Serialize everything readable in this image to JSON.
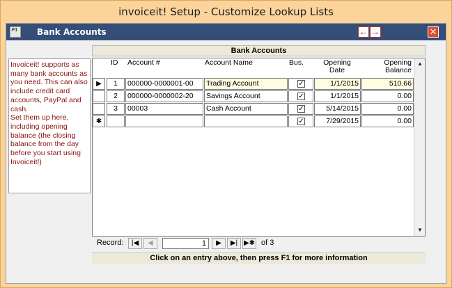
{
  "window": {
    "title": "invoiceit! Setup - Customize Lookup Lists"
  },
  "form": {
    "f1_icon": "F1",
    "title": "Bank Accounts",
    "arrow_left": "←",
    "arrow_right": "→",
    "close": "✕"
  },
  "info": {
    "text": "Invoiceit! supports as many bank accounts as you need. This can also include credit card accounts, PayPal and cash.\nSet them up here, including opening balance (the closing balance from the day before you start using Invoiceit!)"
  },
  "grid": {
    "section_title": "Bank Accounts",
    "columns": {
      "id": "ID",
      "account_no": "Account #",
      "account_name": "Account Name",
      "bus": "Bus.",
      "opening_date": "Opening Date",
      "opening_balance": "Opening Balance"
    },
    "rows": [
      {
        "selector": "▶",
        "id": "1",
        "account_no": "000000-0000001-00",
        "account_name": "Trading Account",
        "bus": true,
        "opening_date": "1/1/2015",
        "opening_balance": "510.66"
      },
      {
        "selector": "",
        "id": "2",
        "account_no": "000000-0000002-20",
        "account_name": "Savings Account",
        "bus": true,
        "opening_date": "1/1/2015",
        "opening_balance": "0.00"
      },
      {
        "selector": "",
        "id": "3",
        "account_no": "00003",
        "account_name": "Cash Account",
        "bus": true,
        "opening_date": "5/14/2015",
        "opening_balance": "0.00"
      },
      {
        "selector": "✱",
        "id": "",
        "account_no": "",
        "account_name": "",
        "bus": true,
        "opening_date": "7/29/2015",
        "opening_balance": "0.00"
      }
    ],
    "check_glyph": "✓",
    "scroll_up": "▲",
    "scroll_down": "▼"
  },
  "navigation": {
    "label": "Record:",
    "first": "|◀",
    "prev": "◀",
    "current": "1",
    "next": "▶",
    "last": "▶|",
    "new": "▶✱",
    "of_text": "of 3"
  },
  "status": {
    "text": "Click on an entry above, then press F1 for more information"
  }
}
